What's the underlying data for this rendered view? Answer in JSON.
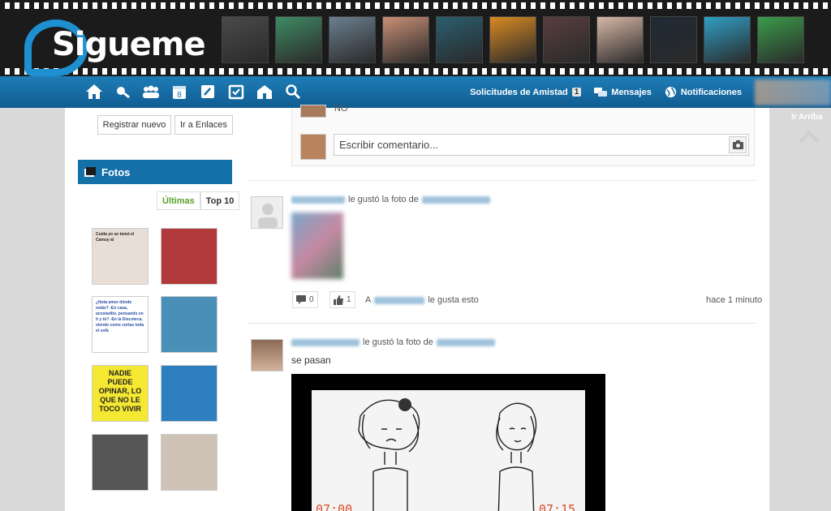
{
  "app": {
    "logo_text": "Sigueme"
  },
  "film_photos": [
    {
      "icon": "profile-photo",
      "color": "#4a4a4a"
    },
    {
      "icon": "profile-photo",
      "color": "#3f8a63"
    },
    {
      "icon": "profile-photo",
      "color": "#6b7f8f"
    },
    {
      "icon": "profile-photo",
      "color": "#c98f76"
    },
    {
      "icon": "profile-photo",
      "color": "#2b5e6f"
    },
    {
      "icon": "profile-photo",
      "color": "#d98a23"
    },
    {
      "icon": "profile-photo",
      "color": "#5a3e3e"
    },
    {
      "icon": "profile-photo",
      "color": "#d8b7a6"
    },
    {
      "icon": "profile-photo",
      "color": "#202a35"
    },
    {
      "icon": "profile-photo",
      "color": "#2f9ec4"
    },
    {
      "icon": "profile-photo",
      "color": "#3b9b4b"
    }
  ],
  "nav": {
    "icons": [
      "home-icon",
      "feed-icon",
      "friends-icon",
      "calendar-icon",
      "edit-icon",
      "tasks-icon",
      "places-icon",
      "search-icon"
    ],
    "friend_requests_label": "Solicitudes de Amistad",
    "friend_requests_count": "1",
    "messages_label": "Mensajes",
    "notifications_label": "Notificaciones"
  },
  "sidebar": {
    "register_label": "Registrar nuevo",
    "links_label": "Ir a Enlaces",
    "photos_title": "Fotos",
    "tab_latest": "Últimas",
    "tab_top": "Top 10",
    "thumbnails": [
      {
        "text": "Cuida yo se tomó el Camuy al",
        "bg": "#e9ded6"
      },
      {
        "text": "",
        "bg": "#b33a3a"
      },
      {
        "text": "¿Nota amor dónde estás? -En casa, acostadito, pensando en ti y tú? -En la Discoteca, viendo como cortas toda el sofá",
        "bg": "#ffffff"
      },
      {
        "text": "",
        "bg": "#4a8fb8"
      },
      {
        "text": "NADIE PUEDE OPINAR, LO QUE NO LE TOCO VIVIR",
        "bg": "#f5e832"
      },
      {
        "text": "",
        "bg": "#2d7fbf"
      },
      {
        "text": "",
        "bg": "#555555"
      },
      {
        "text": "",
        "bg": "#cfc2b6"
      }
    ]
  },
  "feed": {
    "prev_comment_text": "NO",
    "comment_placeholder": "Escribir comentario...",
    "post1": {
      "liked_photo_text": "le gustó la foto de",
      "comments_count": "0",
      "likes_count": "1",
      "likes_prefix": "A",
      "likes_suffix": "le gusta esto",
      "time": "hace 1 minuto"
    },
    "post2": {
      "liked_photo_text": "le gustó la foto de",
      "caption": "se pasan",
      "time_left": "07:00",
      "time_right": "07:15"
    }
  },
  "gutter": {
    "back_to_top": "Ir Arriba"
  },
  "colors": {
    "brand": "#1570a8",
    "nav_gradient_top": "#1f7cb6",
    "accent_green": "#5aa02c"
  }
}
